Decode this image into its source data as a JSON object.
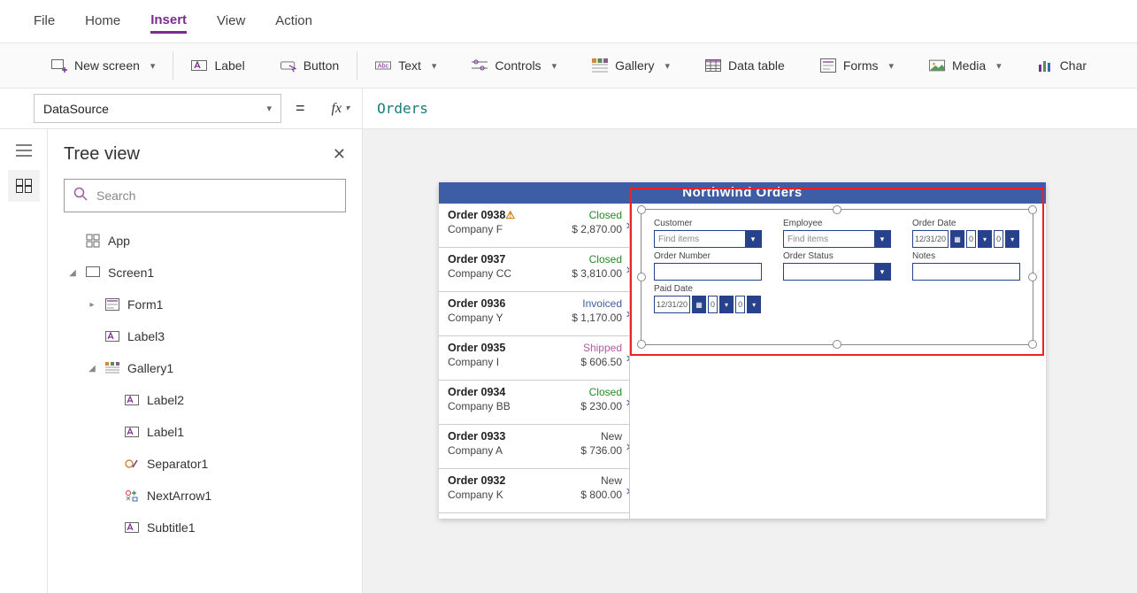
{
  "menubar": [
    "File",
    "Home",
    "Insert",
    "View",
    "Action"
  ],
  "menubar_active": 2,
  "ribbon": {
    "new_screen": "New screen",
    "label": "Label",
    "button": "Button",
    "text": "Text",
    "controls": "Controls",
    "gallery": "Gallery",
    "data_table": "Data table",
    "forms": "Forms",
    "media": "Media",
    "chart": "Char"
  },
  "property_dropdown": "DataSource",
  "formula_value": "Orders",
  "tree_panel": {
    "title": "Tree view",
    "search_placeholder": "Search",
    "nodes": {
      "app": "App",
      "screen1": "Screen1",
      "form1": "Form1",
      "label3": "Label3",
      "gallery1": "Gallery1",
      "label2": "Label2",
      "label1": "Label1",
      "separator1": "Separator1",
      "nextarrow1": "NextArrow1",
      "subtitle1": "Subtitle1"
    }
  },
  "app": {
    "title": "Northwind Orders",
    "orders": [
      {
        "num": "Order 0938",
        "warn": true,
        "company": "Company F",
        "amount": "$ 2,870.00",
        "status": "Closed",
        "status_class": "st-closed"
      },
      {
        "num": "Order 0937",
        "warn": false,
        "company": "Company CC",
        "amount": "$ 3,810.00",
        "status": "Closed",
        "status_class": "st-closed"
      },
      {
        "num": "Order 0936",
        "warn": false,
        "company": "Company Y",
        "amount": "$ 1,170.00",
        "status": "Invoiced",
        "status_class": "st-invoiced"
      },
      {
        "num": "Order 0935",
        "warn": false,
        "company": "Company I",
        "amount": "$ 606.50",
        "status": "Shipped",
        "status_class": "st-shipped"
      },
      {
        "num": "Order 0934",
        "warn": false,
        "company": "Company BB",
        "amount": "$ 230.00",
        "status": "Closed",
        "status_class": "st-closed"
      },
      {
        "num": "Order 0933",
        "warn": false,
        "company": "Company A",
        "amount": "$ 736.00",
        "status": "New",
        "status_class": "st-new"
      },
      {
        "num": "Order 0932",
        "warn": false,
        "company": "Company K",
        "amount": "$ 800.00",
        "status": "New",
        "status_class": "st-new"
      }
    ],
    "form": {
      "customer_label": "Customer",
      "customer_ph": "Find items",
      "employee_label": "Employee",
      "employee_ph": "Find items",
      "orderdate_label": "Order Date",
      "orderdate_val": "12/31/20",
      "ordernum_label": "Order Number",
      "orderstatus_label": "Order Status",
      "notes_label": "Notes",
      "paiddate_label": "Paid Date",
      "paiddate_val": "12/31/20",
      "spin0": "0"
    }
  }
}
